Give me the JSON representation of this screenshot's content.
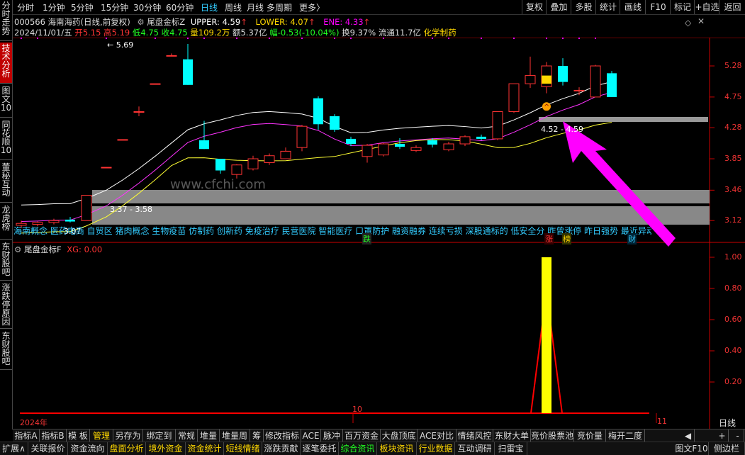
{
  "left_tabs": [
    {
      "label": "分时走势",
      "active": false
    },
    {
      "label": "技术分析",
      "active": true
    },
    {
      "label": "图文10",
      "active": false
    },
    {
      "label": "同花顺10",
      "active": false
    },
    {
      "label": "董秘互动",
      "active": false
    },
    {
      "label": "龙虎榜",
      "active": false
    },
    {
      "label": "东财股吧",
      "active": false
    },
    {
      "label": "涨跌停原因",
      "active": false
    },
    {
      "label": "东财股吧",
      "active": false
    }
  ],
  "periods": [
    "分时",
    "1分钟",
    "5分钟",
    "15分钟",
    "30分钟",
    "60分钟",
    "日线",
    "周线",
    "月线",
    "多周期",
    "更多〉"
  ],
  "active_period": "日线",
  "toolbar_right": [
    "复权",
    "叠加",
    "多股",
    "统计",
    "画线",
    "F10",
    "标记",
    "+自选",
    "返回"
  ],
  "stock": {
    "title": "000566 海南海药(日线,前复权)",
    "indicator_name": "尾盘金标Z",
    "upper": "UPPER: 4.59",
    "lower": "LOWER: 4.07",
    "ene": "ENE: 4.33",
    "date": "2024/11/01/五",
    "open": "开5.15",
    "high": "高5.19",
    "low": "低4.75",
    "close": "收4.75",
    "volume": "量109.2万",
    "amount": "额5.37亿",
    "change": "幅-0.53(-10.04%)",
    "turnover": "换9.37%",
    "float": "流通11.7亿",
    "sector": "化学制药"
  },
  "price_axis": [
    "5.28",
    "4.75",
    "4.28",
    "3.85",
    "3.46",
    "3.12"
  ],
  "annotations": {
    "max_label": "5.69",
    "band_low_label": "3.37 - 3.58",
    "band_high_label": "4.52 - 4.59",
    "min_label": "3.07"
  },
  "concept_strip": "海南概念 医药电商 自贸区 猪肉概念 生物疫苗 仿制药 创新药 免疫治疗 民营医院 智能医疗 口罩防护 融资融券 连续亏损 深股通标的 低安全分 昨曾涨停 昨日强势 最近异动",
  "markers": [
    {
      "text": "跌",
      "color": "#2f2"
    },
    {
      "text": "涨",
      "color": "#f33"
    },
    {
      "text": "榜",
      "color": "#ffd800"
    },
    {
      "text": "财",
      "color": "#3cf"
    }
  ],
  "sub_indicator": {
    "name": "尾盘金标F",
    "xg": "XG: 0.00",
    "axis": [
      "1.00",
      "0.80",
      "0.60",
      "0.40",
      "0.20"
    ]
  },
  "time_axis": [
    "2024年",
    "10",
    "11"
  ],
  "time_axis_right": "日线",
  "bottom_tabs": [
    "指标A",
    "指标B",
    "模 板",
    "管理",
    "另存为",
    "绑定到",
    "常规",
    "堆量",
    "堆量周",
    "筹",
    "修改指标",
    "ACE",
    "脉冲",
    "百万资金",
    "大盘顶底",
    "ACE对比",
    "情绪风控",
    "东财大单",
    "竞价股票池",
    "竞价量",
    "梅开二度"
  ],
  "active_bottom_tab": "管理",
  "bottom_scroll": [
    "◀",
    "+",
    "-"
  ],
  "status_tabs": [
    "扩展∧",
    "关联报价",
    "资金流向",
    "盘面分析",
    "境外资金",
    "资金统计",
    "短线情绪",
    "涨跌贡献",
    "逐笔委托",
    "综合资讯",
    "板块资讯",
    "行业数据",
    "互动调研",
    "扫雷宝"
  ],
  "status_right": [
    "图文F10",
    "侧边栏"
  ],
  "watermark": "www.cfchi.com",
  "chart_data": {
    "type": "candlestick",
    "dates_note": "daily candles, Sep–Nov 2024",
    "candles": [
      {
        "o": 3.07,
        "h": 3.12,
        "l": 3.04,
        "c": 3.09
      },
      {
        "o": 3.08,
        "h": 3.11,
        "l": 3.06,
        "c": 3.1
      },
      {
        "o": 3.1,
        "h": 3.14,
        "l": 3.08,
        "c": 3.12
      },
      {
        "o": 3.13,
        "h": 3.16,
        "l": 3.1,
        "c": 3.11
      },
      {
        "o": 3.12,
        "h": 3.4,
        "l": 3.12,
        "c": 3.4
      },
      {
        "o": 3.74,
        "h": 3.74,
        "l": 3.74,
        "c": 3.74
      },
      {
        "o": 4.11,
        "h": 4.11,
        "l": 4.11,
        "c": 4.11
      },
      {
        "o": 4.52,
        "h": 4.6,
        "l": 4.45,
        "c": 4.52
      },
      {
        "o": 4.97,
        "h": 4.97,
        "l": 4.97,
        "c": 4.97
      },
      {
        "o": 5.47,
        "h": 5.51,
        "l": 5.47,
        "c": 5.47
      },
      {
        "o": 5.4,
        "h": 5.69,
        "l": 4.95,
        "c": 4.95
      },
      {
        "o": 4.1,
        "h": 4.38,
        "l": 3.98,
        "c": 3.98
      },
      {
        "o": 3.85,
        "h": 3.85,
        "l": 3.66,
        "c": 3.7
      },
      {
        "o": 3.65,
        "h": 3.78,
        "l": 3.6,
        "c": 3.77
      },
      {
        "o": 3.72,
        "h": 3.89,
        "l": 3.7,
        "c": 3.85
      },
      {
        "o": 3.8,
        "h": 3.92,
        "l": 3.77,
        "c": 3.89
      },
      {
        "o": 3.85,
        "h": 4.0,
        "l": 3.85,
        "c": 3.95
      },
      {
        "o": 4.0,
        "h": 4.32,
        "l": 3.95,
        "c": 4.3
      },
      {
        "o": 4.73,
        "h": 4.76,
        "l": 4.25,
        "c": 4.33
      },
      {
        "o": 4.45,
        "h": 4.48,
        "l": 4.22,
        "c": 4.25
      },
      {
        "o": 4.12,
        "h": 4.15,
        "l": 4.02,
        "c": 4.05
      },
      {
        "o": 3.88,
        "h": 4.05,
        "l": 3.8,
        "c": 4.03
      },
      {
        "o": 3.9,
        "h": 4.06,
        "l": 3.88,
        "c": 4.05
      },
      {
        "o": 4.05,
        "h": 4.13,
        "l": 3.98,
        "c": 4.01
      },
      {
        "o": 3.96,
        "h": 4.03,
        "l": 3.94,
        "c": 4.0
      },
      {
        "o": 4.1,
        "h": 4.13,
        "l": 4.0,
        "c": 4.04
      },
      {
        "o": 3.97,
        "h": 4.08,
        "l": 3.95,
        "c": 4.05
      },
      {
        "o": 4.05,
        "h": 4.17,
        "l": 4.02,
        "c": 4.15
      },
      {
        "o": 4.15,
        "h": 4.18,
        "l": 4.1,
        "c": 4.12
      },
      {
        "o": 4.12,
        "h": 4.52,
        "l": 4.1,
        "c": 4.52
      },
      {
        "o": 4.52,
        "h": 4.97,
        "l": 4.5,
        "c": 4.97
      },
      {
        "o": 4.97,
        "h": 5.45,
        "l": 4.9,
        "c": 5.11
      },
      {
        "o": 4.92,
        "h": 5.35,
        "l": 4.81,
        "c": 5.28
      },
      {
        "o": 5.28,
        "h": 5.42,
        "l": 4.94,
        "c": 5.0
      },
      {
        "o": 4.85,
        "h": 4.91,
        "l": 4.78,
        "c": 4.86
      },
      {
        "o": 4.75,
        "h": 5.3,
        "l": 4.75,
        "c": 5.28
      },
      {
        "o": 5.15,
        "h": 5.19,
        "l": 4.75,
        "c": 4.75
      }
    ],
    "upper_band_last": 4.59,
    "lower_band_last": 4.07,
    "ene_last": 4.33,
    "xg_signal_index": 33,
    "xg_signal_value": 1.0
  }
}
